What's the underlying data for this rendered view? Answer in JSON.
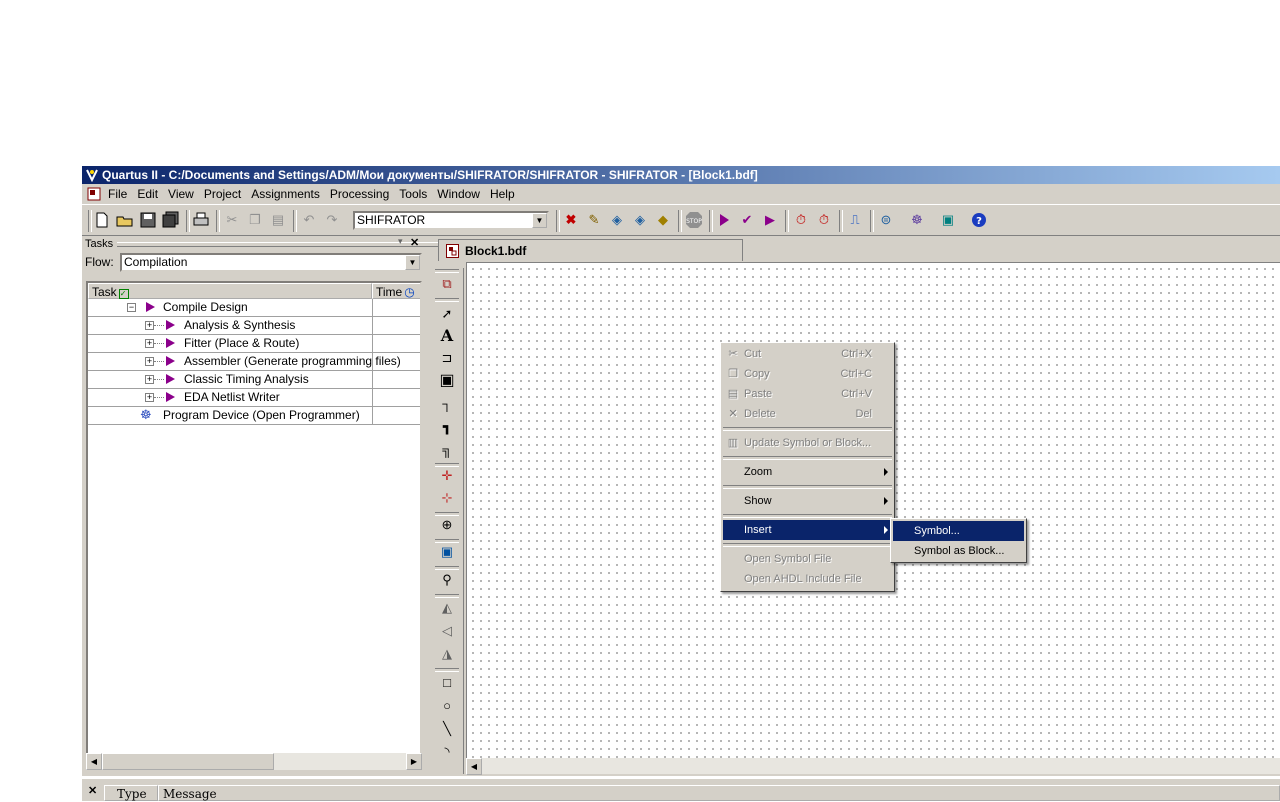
{
  "window": {
    "title": "Quartus II - C:/Documents and Settings/ADM/Мои документы/SHIFRATOR/SHIFRATOR - SHIFRATOR - [Block1.bdf]"
  },
  "menubar": {
    "items": [
      "File",
      "Edit",
      "View",
      "Project",
      "Assignments",
      "Processing",
      "Tools",
      "Window",
      "Help"
    ]
  },
  "toolbar": {
    "project_combo_value": "SHIFRATOR"
  },
  "tasks_panel": {
    "title": "Tasks",
    "flow_label": "Flow:",
    "flow_value": "Compilation",
    "columns": [
      "Task",
      "Time"
    ],
    "rows": [
      {
        "label": "Compile Design"
      },
      {
        "label": "Analysis & Synthesis"
      },
      {
        "label": "Fitter (Place & Route)"
      },
      {
        "label": "Assembler (Generate programming files)"
      },
      {
        "label": "Classic Timing Analysis"
      },
      {
        "label": "EDA Netlist Writer"
      },
      {
        "label": "Program Device (Open Programmer)"
      }
    ]
  },
  "document_tab": {
    "label": "Block1.bdf"
  },
  "context_menu": {
    "items": [
      {
        "label": "Cut",
        "shortcut": "Ctrl+X",
        "enabled": false,
        "icon": "scissors-icon"
      },
      {
        "label": "Copy",
        "shortcut": "Ctrl+C",
        "enabled": false,
        "icon": "copy-icon"
      },
      {
        "label": "Paste",
        "shortcut": "Ctrl+V",
        "enabled": false,
        "icon": "paste-icon"
      },
      {
        "label": "Delete",
        "shortcut": "Del",
        "enabled": false,
        "icon": "delete-icon"
      },
      {
        "label": "Update Symbol or Block...",
        "enabled": false,
        "icon": "update-symbol-icon"
      },
      {
        "label": "Zoom",
        "submenu": true,
        "enabled": true
      },
      {
        "label": "Show",
        "submenu": true,
        "enabled": true
      },
      {
        "label": "Insert",
        "submenu": true,
        "enabled": true,
        "selected": true
      },
      {
        "label": "Open Symbol File",
        "enabled": false
      },
      {
        "label": "Open AHDL Include File",
        "enabled": false
      }
    ]
  },
  "insert_submenu": {
    "items": [
      {
        "label": "Symbol...",
        "selected": true
      },
      {
        "label": "Symbol as Block..."
      }
    ]
  },
  "messages_panel": {
    "columns": [
      "Type",
      "Message"
    ]
  },
  "colors": {
    "selection": "#0a246a",
    "face": "#d4d0c8",
    "task_play": "#8b008b"
  }
}
